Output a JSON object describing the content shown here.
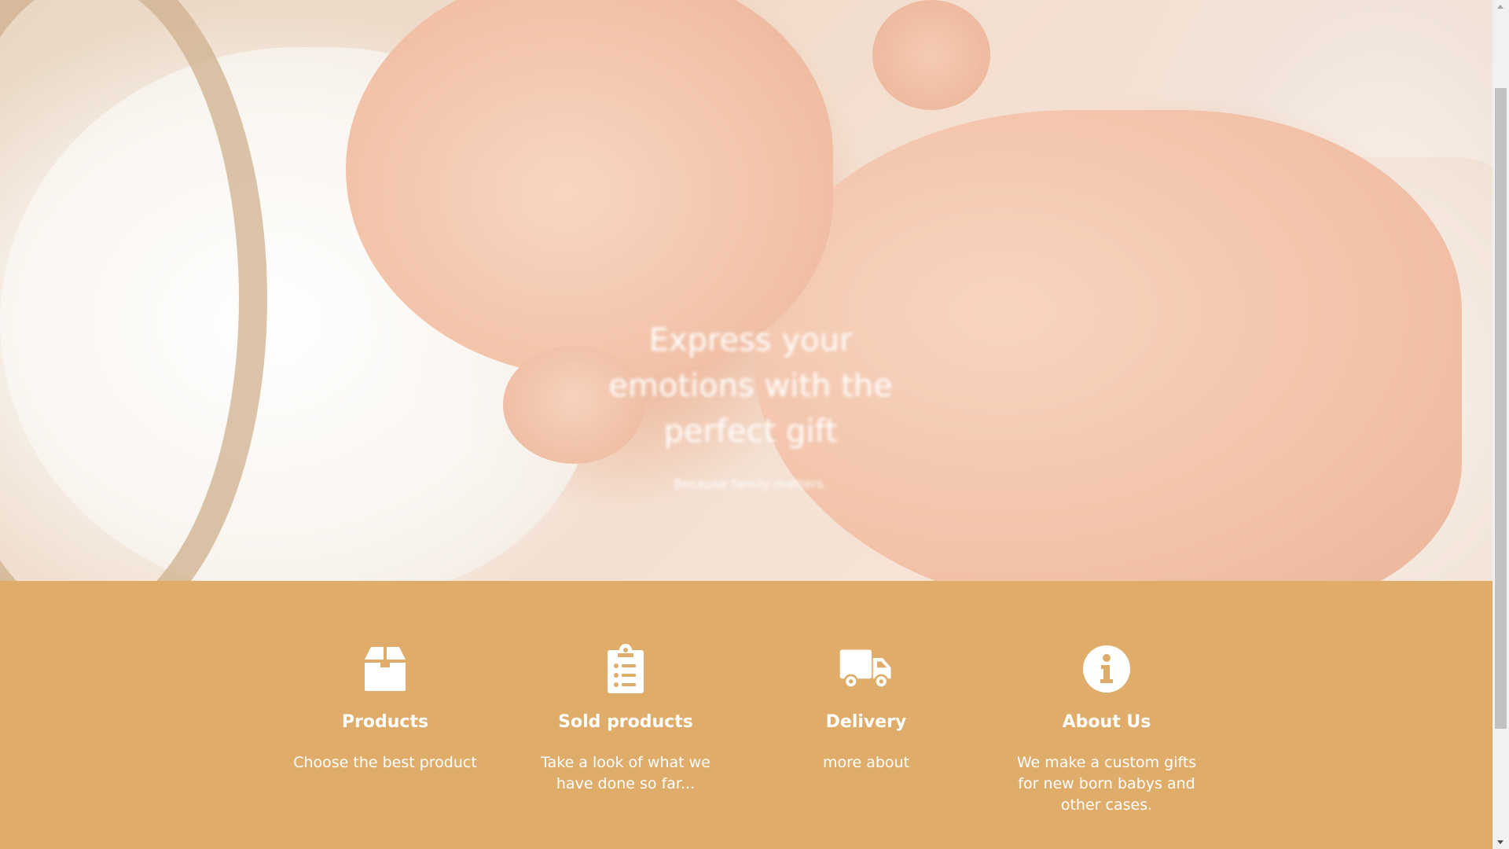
{
  "hero": {
    "title": "Express your emotions with the perfect gift",
    "subtitle": "Because family matters.",
    "image": "sleeping-baby-photo"
  },
  "features": {
    "background_color": "#dfac6a",
    "items": [
      {
        "icon": "box-icon",
        "title": "Products",
        "text": "Choose the best product"
      },
      {
        "icon": "clipboard-list-icon",
        "title": "Sold products",
        "text": "Take a look of what we have done so far..."
      },
      {
        "icon": "truck-icon",
        "title": "Delivery",
        "text": "more about"
      },
      {
        "icon": "info-circle-icon",
        "title": "About Us",
        "text": "We make a custom gifts for new born babys and other cases."
      }
    ]
  }
}
